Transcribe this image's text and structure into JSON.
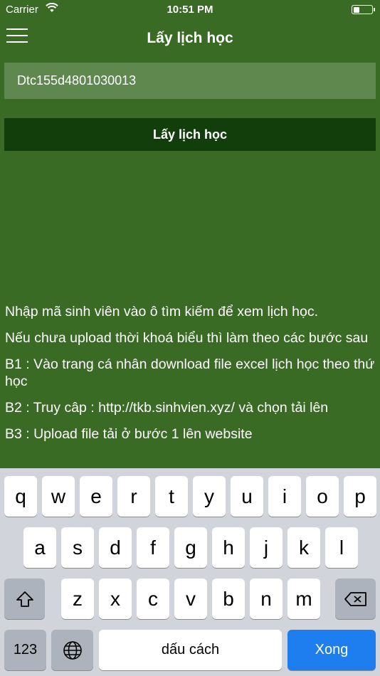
{
  "status_bar": {
    "carrier": "Carrier",
    "time": "10:51 PM",
    "battery_level": 0.4
  },
  "nav": {
    "title": "Lấy lịch học"
  },
  "search": {
    "value": "Dtc155d4801030013"
  },
  "fetch_button": {
    "label": "Lấy lịch học"
  },
  "instructions": [
    "Nhập mã sinh viên vào ô tìm kiếm để xem lịch học.",
    "Nếu chưa upload thời khoá biểu thì làm theo các bước sau",
    "B1 : Vào trang cá nhân download file excel lịch học theo thứ học",
    "B2 : Truy câp : http://tkb.sinhvien.xyz/ và chọn tải lên",
    "B3 : Upload file tải ở bước 1 lên website"
  ],
  "keyboard": {
    "row1": [
      "q",
      "w",
      "e",
      "r",
      "t",
      "y",
      "u",
      "i",
      "o",
      "p"
    ],
    "row2": [
      "a",
      "s",
      "d",
      "f",
      "g",
      "h",
      "j",
      "k",
      "l"
    ],
    "row3": [
      "z",
      "x",
      "c",
      "v",
      "b",
      "n",
      "m"
    ],
    "numbers_label": "123",
    "space_label": "dấu cách",
    "return_label": "Xong"
  },
  "colors": {
    "background": "#3a6b25",
    "button": "#123e0c",
    "return_key": "#1f7eef"
  }
}
